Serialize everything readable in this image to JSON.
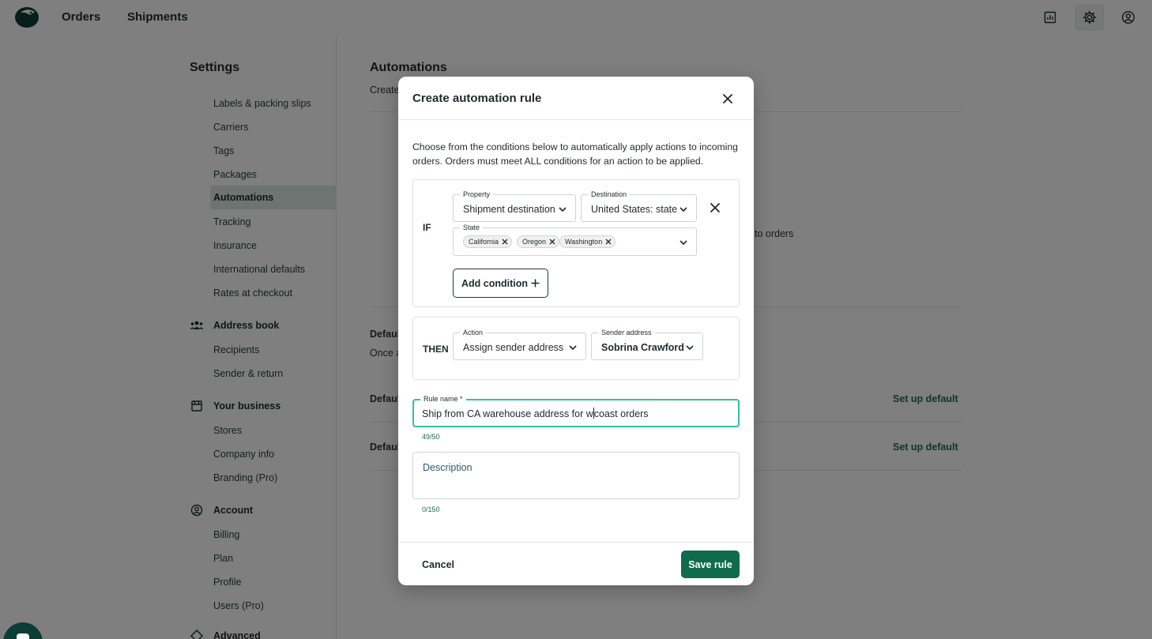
{
  "nav": {
    "orders": "Orders",
    "shipments": "Shipments",
    "icons": [
      "reports-icon",
      "gear-icon",
      "account-icon"
    ]
  },
  "sidebar": {
    "title": "Settings",
    "shipping_items": [
      "Labels & packing slips",
      "Carriers",
      "Tags",
      "Packages",
      "Automations",
      "Tracking",
      "Insurance",
      "International defaults",
      "Rates at checkout"
    ],
    "active_item": "Automations",
    "address_book": {
      "label": "Address book",
      "items": [
        "Recipients",
        "Sender & return"
      ]
    },
    "your_business": {
      "label": "Your business",
      "items": [
        "Stores",
        "Company info",
        "Branding (Pro)"
      ]
    },
    "account": {
      "label": "Account",
      "items": [
        "Billing",
        "Plan",
        "Profile",
        "Users (Pro)"
      ]
    },
    "advanced": {
      "label": "Advanced"
    }
  },
  "main": {
    "title": "Automations",
    "subtitle": "Create",
    "partial_text": "to orders",
    "default_1": "Defaul",
    "default_1_sub": "Once a",
    "default_2": "Defaul",
    "default_3": "Defaul",
    "setup_link": "Set up default"
  },
  "modal": {
    "title": "Create automation rule",
    "intro": "Choose from the conditions below to automatically apply actions to incoming orders. Orders must meet ALL conditions for an action to be applied.",
    "if_label": "IF",
    "property_label": "Property",
    "property_value": "Shipment destination",
    "destination_label": "Destination",
    "destination_value": "United States: state",
    "state_label": "State",
    "states": [
      "California",
      "Oregon",
      "Washington"
    ],
    "add_condition": "Add condition",
    "then_label": "THEN",
    "action_label": "Action",
    "action_value": "Assign sender address",
    "sender_label": "Sender address",
    "sender_value": "Sobrina Crawford",
    "rule_name_label": "Rule name *",
    "rule_name_before_caret": "Ship from CA warehouse address for w",
    "rule_name_after_caret": "coast orders",
    "rule_name_counter": "49/50",
    "description_placeholder": "Description",
    "description_counter": "0/150",
    "cancel": "Cancel",
    "save": "Save rule"
  },
  "colors": {
    "primary": "#0f6b4c",
    "focus": "#2fc59a",
    "active_nav_bg": "#dce8e3"
  }
}
